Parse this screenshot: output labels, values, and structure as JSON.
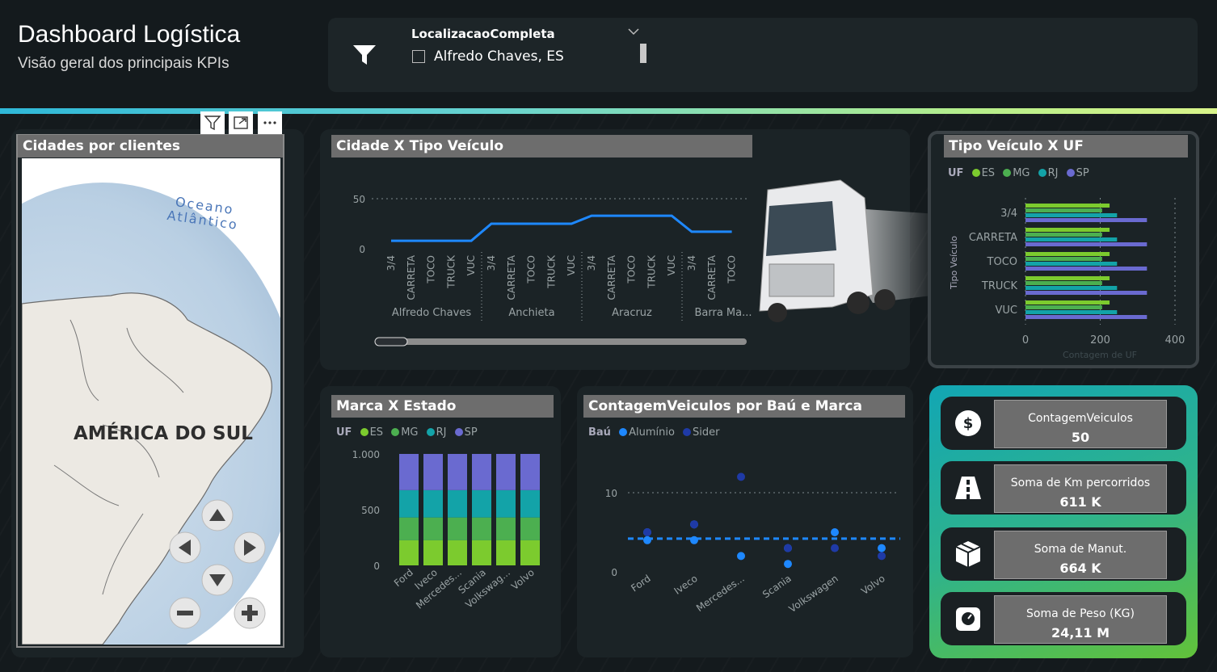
{
  "header": {
    "title": "Dashboard Logística",
    "subtitle": "Visão geral dos principais KPIs"
  },
  "slicer": {
    "field": "LocalizacaoCompleta",
    "option": "Alfredo Chaves, ES",
    "icon": "filter-icon"
  },
  "map": {
    "title": "Cidades por clientes",
    "ocean_label": "Oceano Atlântico",
    "continent_label": "AMÉRICA DO SUL",
    "controls": [
      "arrow-up-icon",
      "arrow-left-icon",
      "arrow-right-icon",
      "arrow-down-icon",
      "zoom-out-icon",
      "zoom-in-icon"
    ]
  },
  "visual_toolbar": {
    "icons": [
      "filter-icon",
      "focus-mode-icon",
      "more-options-icon"
    ]
  },
  "city_chart": {
    "title": "Cidade X Tipo Veículo",
    "chart_data": {
      "type": "line",
      "ylim": [
        0,
        50
      ],
      "yticks": [
        "50",
        "0"
      ],
      "x": [
        "3/4",
        "CARRETA",
        "TOCO",
        "TRUCK",
        "VUC",
        "3/4",
        "CARRETA",
        "TOCO",
        "TRUCK",
        "VUC",
        "3/4",
        "CARRETA",
        "TOCO",
        "TRUCK",
        "VUC",
        "3/4",
        "CARRETA",
        "TOCO"
      ],
      "groups": [
        "Alfredo Chaves",
        "Anchieta",
        "Aracruz",
        "Barra Ma..."
      ],
      "values": [
        8,
        8,
        8,
        8,
        8,
        25,
        25,
        25,
        25,
        25,
        33,
        33,
        33,
        33,
        33,
        17,
        17,
        17
      ],
      "color": "#1e88ff"
    }
  },
  "uf_chart": {
    "title": "Tipo Veículo X UF",
    "legend_title": "UF",
    "legend": [
      {
        "name": "ES",
        "color": "#7ccb2e"
      },
      {
        "name": "MG",
        "color": "#4caf50"
      },
      {
        "name": "RJ",
        "color": "#13a3a8"
      },
      {
        "name": "SP",
        "color": "#6a6ad0"
      }
    ],
    "chart_data": {
      "type": "bar",
      "orientation": "horizontal",
      "categories": [
        "3/4",
        "CARRETA",
        "TOCO",
        "TRUCK",
        "VUC"
      ],
      "series": [
        {
          "name": "ES",
          "values": [
            225,
            225,
            225,
            225,
            225
          ]
        },
        {
          "name": "MG",
          "values": [
            205,
            205,
            205,
            205,
            205
          ]
        },
        {
          "name": "RJ",
          "values": [
            245,
            245,
            245,
            245,
            245
          ]
        },
        {
          "name": "SP",
          "values": [
            325,
            325,
            325,
            325,
            325
          ]
        }
      ],
      "xlim": [
        0,
        400
      ],
      "xticks": [
        "0",
        "200",
        "400"
      ],
      "ylabel": "Tipo Veículo",
      "xlabel": "Contagem de UF"
    }
  },
  "brand_chart": {
    "title": "Marca X Estado",
    "legend_title": "UF",
    "legend": [
      {
        "name": "ES",
        "color": "#7ccb2e"
      },
      {
        "name": "MG",
        "color": "#4caf50"
      },
      {
        "name": "RJ",
        "color": "#13a3a8"
      },
      {
        "name": "SP",
        "color": "#6a6ad0"
      }
    ],
    "chart_data": {
      "type": "bar",
      "stacked": true,
      "categories": [
        "Ford",
        "Iveco",
        "Mercedes...",
        "Scania",
        "Volkswag...",
        "Volvo"
      ],
      "series": [
        {
          "name": "ES",
          "values": [
            225,
            225,
            225,
            225,
            225,
            225
          ]
        },
        {
          "name": "MG",
          "values": [
            205,
            205,
            205,
            205,
            205,
            205
          ]
        },
        {
          "name": "RJ",
          "values": [
            245,
            245,
            245,
            245,
            245,
            245
          ]
        },
        {
          "name": "SP",
          "values": [
            325,
            325,
            325,
            325,
            325,
            325
          ]
        }
      ],
      "ylim": [
        0,
        1000
      ],
      "yticks": [
        "1.000",
        "500",
        "0"
      ]
    }
  },
  "bau_chart": {
    "title": "ContagemVeiculos por Baú e Marca",
    "legend_title": "Baú",
    "legend": [
      {
        "name": "Alumínio",
        "color": "#1e88ff"
      },
      {
        "name": "Sider",
        "color": "#1f3aa6"
      }
    ],
    "chart_data": {
      "type": "scatter",
      "categories": [
        "Ford",
        "Iveco",
        "Mercedes...",
        "Scania",
        "Volkswagen",
        "Volvo"
      ],
      "series": [
        {
          "name": "Alumínio",
          "values": [
            [
              5,
              4
            ],
            [
              4,
              6
            ],
            [
              2
            ],
            [
              1,
              3
            ],
            [
              5
            ],
            [
              3
            ]
          ]
        },
        {
          "name": "Sider",
          "values": [
            [
              5
            ],
            [
              6
            ],
            [
              12
            ],
            [
              3
            ],
            [
              3
            ],
            [
              2
            ]
          ]
        }
      ],
      "average": 4.2,
      "ylim": [
        0,
        12
      ],
      "yticks": [
        "10",
        "0"
      ]
    }
  },
  "kpis": [
    {
      "label": "ContagemVeiculos",
      "value": "50",
      "icon": "dollar-icon"
    },
    {
      "label": "Soma de Km percorridos",
      "value": "611 K",
      "icon": "road-icon"
    },
    {
      "label": "Soma de Manut.",
      "value": "664 K",
      "icon": "package-icon"
    },
    {
      "label": "Soma de Peso (KG)",
      "value": "24,11 M",
      "icon": "weight-scale-icon"
    }
  ]
}
